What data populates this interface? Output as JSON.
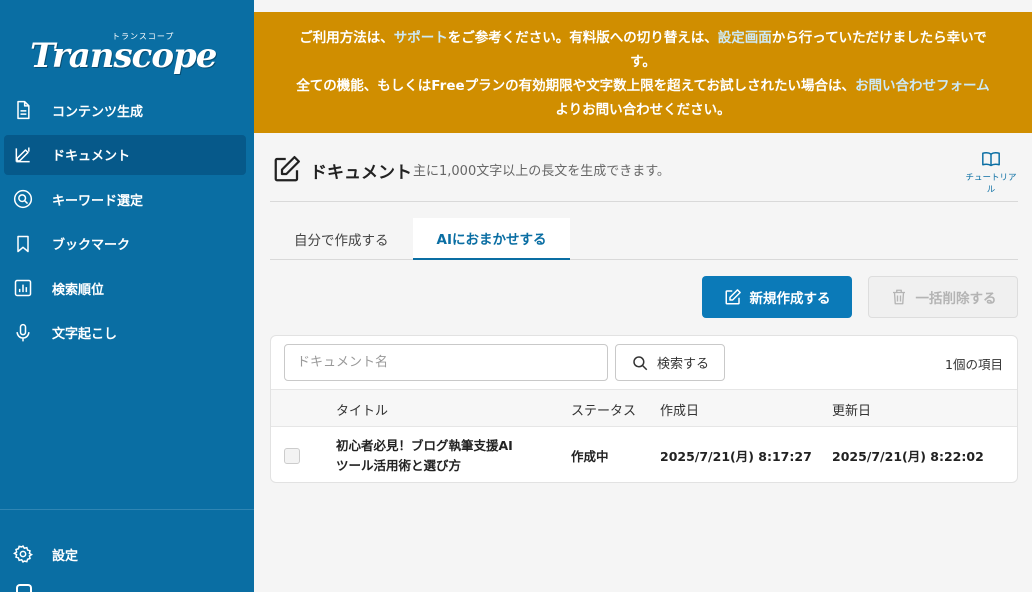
{
  "sidebar": {
    "logo_sub": "トランスコープ",
    "logo": "Transcope",
    "items": [
      {
        "label": "コンテンツ生成",
        "icon": "document-icon"
      },
      {
        "label": "ドキュメント",
        "icon": "pencil-icon"
      },
      {
        "label": "キーワード選定",
        "icon": "search-circle-icon"
      },
      {
        "label": "ブックマーク",
        "icon": "bookmark-icon"
      },
      {
        "label": "検索順位",
        "icon": "bar-chart-icon"
      },
      {
        "label": "文字起こし",
        "icon": "microphone-icon"
      }
    ],
    "active_index": 1,
    "settings_label": "設定"
  },
  "banner": {
    "line1_pre": "ご利用方法は、",
    "line1_link1": "サポート",
    "line1_mid": "をご参考ください。有料版への切り替えは、",
    "line1_link2": "設定画面",
    "line1_post": "から行っていただけましたら幸いで",
    "line2": "す。",
    "line3_pre": "全ての機能、もしくはFreeプランの有効期限や文字数上限を超えてお試しされたい場合は、",
    "line3_link": "お問い合わせフォーム",
    "line4": "よりお問い合わせください。"
  },
  "header": {
    "title": "ドキュメント",
    "description": "主に1,000文字以上の長文を生成できます。",
    "tutorial_label": "チュートリアル"
  },
  "tabs": [
    {
      "label": "自分で作成する",
      "active": false
    },
    {
      "label": "AIにおまかせする",
      "active": true
    }
  ],
  "actions": {
    "new_label": "新規作成する",
    "delete_label": "一括削除する"
  },
  "search": {
    "placeholder": "ドキュメント名",
    "value": "",
    "button_label": "検索する"
  },
  "count_label": "1個の項目",
  "table": {
    "headers": [
      "タイトル",
      "ステータス",
      "作成日",
      "更新日"
    ],
    "rows": [
      {
        "title_line1": "初心者必見！ブログ執筆支援AI",
        "title_line2": "ツール活用術と選び方",
        "status": "作成中",
        "created": "2025/7/21(月) 8:17:27",
        "updated": "2025/7/21(月) 8:22:02"
      }
    ]
  },
  "colors": {
    "sidebar": "#0a6ea3",
    "banner": "#d08e00",
    "primary": "#0b7ab8",
    "link": "#cde9f5"
  }
}
